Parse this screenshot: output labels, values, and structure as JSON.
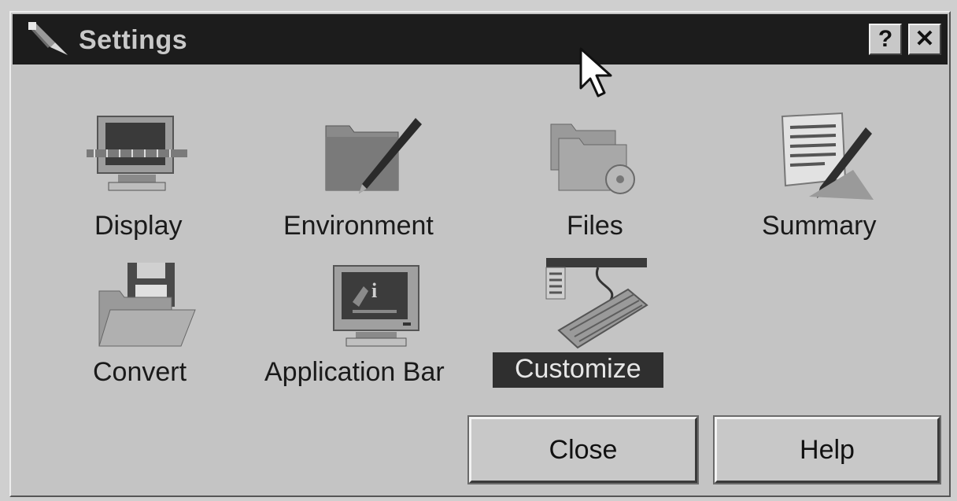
{
  "window": {
    "title": "Settings",
    "help_button": "?",
    "close_button": "✕"
  },
  "items": [
    {
      "label": "Display",
      "icon": "monitor-icon"
    },
    {
      "label": "Environment",
      "icon": "folder-pen-icon"
    },
    {
      "label": "Files",
      "icon": "folders-disc-icon"
    },
    {
      "label": "Summary",
      "icon": "document-pen-icon"
    },
    {
      "label": "Convert",
      "icon": "folder-floppy-icon"
    },
    {
      "label": "Application Bar",
      "icon": "monitor-info-icon"
    },
    {
      "label": "Customize",
      "icon": "keyboard-toolbar-icon",
      "selected": true
    }
  ],
  "buttons": {
    "close": "Close",
    "help": "Help"
  },
  "colors": {
    "titlebar": "#1c1c1c",
    "face": "#c4c4c4",
    "selection": "#2f2f2f"
  }
}
